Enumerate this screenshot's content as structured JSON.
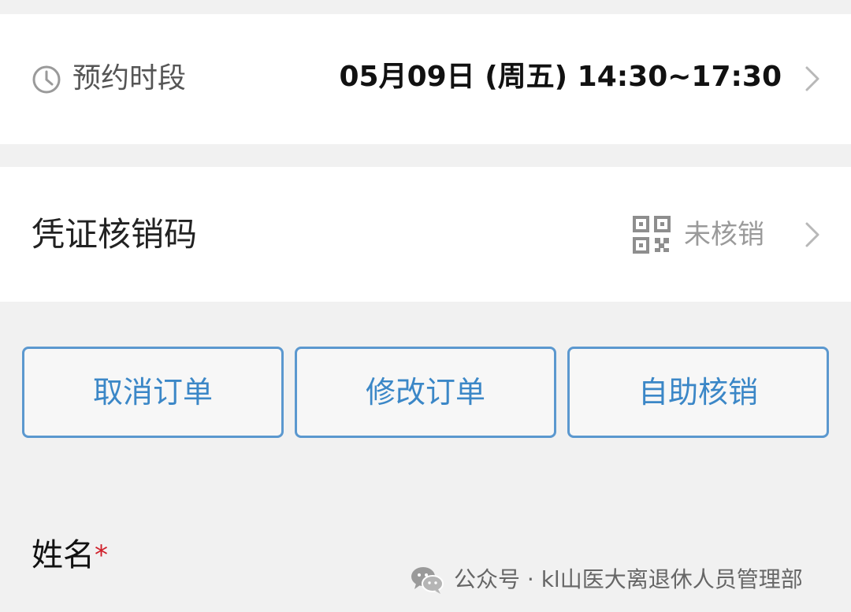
{
  "booking": {
    "icon": "clock-icon",
    "label": "预约时段",
    "value": "05月09日 (周五) 14:30~17:30"
  },
  "voucher": {
    "label": "凭证核销码",
    "icon": "qr-code-icon",
    "status": "未核销"
  },
  "actions": {
    "cancel_label": "取消订单",
    "modify_label": "修改订单",
    "self_verify_label": "自助核销"
  },
  "form": {
    "name_label": "姓名",
    "required_mark": "*"
  },
  "watermark": {
    "icon": "wechat-icon",
    "text": "公众号 · kl山医大离退休人员管理部"
  },
  "colors": {
    "accent": "#3b87c7",
    "button_border": "#5b98cf",
    "required": "#d0202a",
    "background": "#f1f1f1",
    "card": "#ffffff"
  }
}
